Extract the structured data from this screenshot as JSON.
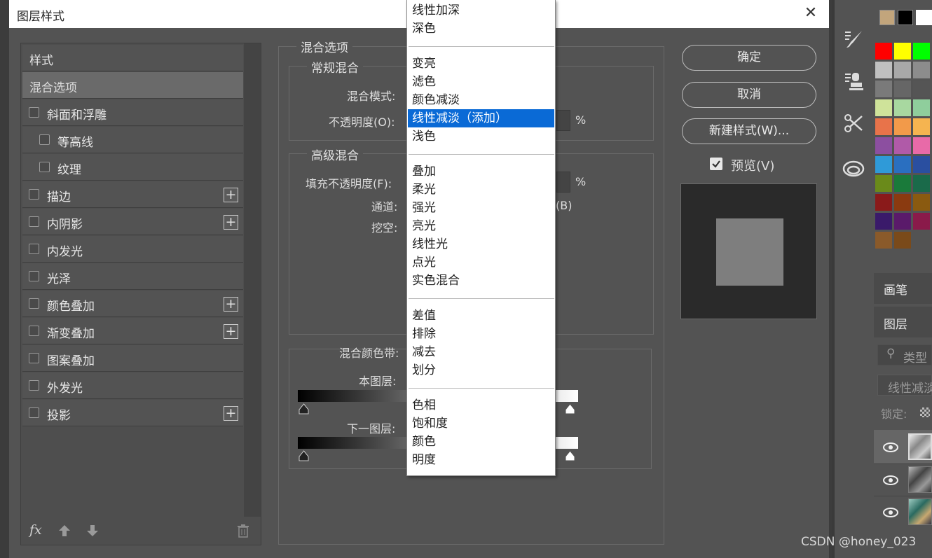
{
  "dialog": {
    "title": "图层样式",
    "close_label": "✕"
  },
  "styles_list": {
    "header": "样式",
    "items": [
      {
        "label": "混合选项",
        "selected": true,
        "checkbox": false,
        "plus": false
      },
      {
        "label": "斜面和浮雕",
        "checkbox": true,
        "plus": false
      },
      {
        "label": "等高线",
        "checkbox": true,
        "indent": true,
        "plus": false
      },
      {
        "label": "纹理",
        "checkbox": true,
        "indent": true,
        "plus": false
      },
      {
        "label": "描边",
        "checkbox": true,
        "plus": true
      },
      {
        "label": "内阴影",
        "checkbox": true,
        "plus": true
      },
      {
        "label": "内发光",
        "checkbox": true,
        "plus": false
      },
      {
        "label": "光泽",
        "checkbox": true,
        "plus": false
      },
      {
        "label": "颜色叠加",
        "checkbox": true,
        "plus": true
      },
      {
        "label": "渐变叠加",
        "checkbox": true,
        "plus": true
      },
      {
        "label": "图案叠加",
        "checkbox": true,
        "plus": false
      },
      {
        "label": "外发光",
        "checkbox": true,
        "plus": false
      },
      {
        "label": "投影",
        "checkbox": true,
        "plus": true
      }
    ],
    "plus_symbol": "+",
    "fx_label": "fx"
  },
  "blend_options": {
    "section_title": "混合选项",
    "general": {
      "title": "常规混合",
      "mode_label": "混合模式:",
      "opacity_label": "不透明度(O):",
      "percent": "%"
    },
    "advanced": {
      "title": "高级混合",
      "fill_label": "填充不透明度(F):",
      "percent": "%",
      "channels_label": "通道:",
      "channel_b": "(B)",
      "knockout_label": "挖空:"
    },
    "blend_if": {
      "label": "混合颜色带:",
      "this_layer": "本图层:",
      "underlying": "下一图层:"
    }
  },
  "dropdown": {
    "groups": [
      [
        "线性加深",
        "深色"
      ],
      [
        "变亮",
        "滤色",
        "颜色减淡",
        "线性减淡（添加）",
        "浅色"
      ],
      [
        "叠加",
        "柔光",
        "强光",
        "亮光",
        "线性光",
        "点光",
        "实色混合"
      ],
      [
        "差值",
        "排除",
        "减去",
        "划分"
      ],
      [
        "色相",
        "饱和度",
        "颜色",
        "明度"
      ]
    ],
    "selected": "线性减淡（添加）"
  },
  "buttons": {
    "ok": "确定",
    "cancel": "取消",
    "new_style": "新建样式(W)...",
    "preview_label": "预览(V)",
    "preview_checked": true
  },
  "right_panel": {
    "tab_brush": "画笔",
    "tab_layers": "图层",
    "search_placeholder": "类型",
    "blend_mode_value": "线性减淡",
    "lock_label": "锁定:"
  },
  "swatches": {
    "colors": [
      "#ff0000",
      "#ffff00",
      "#00ff00",
      "#c0c0c0",
      "#a9a9a9",
      "#8c8c8c",
      "#7a7a7a",
      "#666666",
      "#555555",
      "#cfe39a",
      "#a8d8a0",
      "#8fce9c",
      "#e8734a",
      "#f29a4a",
      "#f5b450",
      "#8c4fa0",
      "#b05aa8",
      "#e86aa8",
      "#2f9ad8",
      "#2a6fc0",
      "#2a4fa0",
      "#6a8a1a",
      "#1a7a3a",
      "#1a6a4a",
      "#8a1a1a",
      "#8a3a10",
      "#8a5a10",
      "#3a1a6a",
      "#5a1a6a",
      "#8a1a4a",
      "#8a5a2a",
      "#7a4a1a"
    ]
  },
  "watermark": "CSDN @honey_023"
}
